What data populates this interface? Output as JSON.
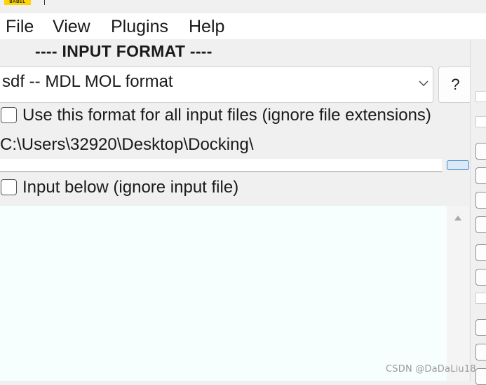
{
  "app": {
    "logo_text": "BABEL"
  },
  "menu": {
    "items": [
      "File",
      "View",
      "Plugins",
      "Help"
    ]
  },
  "input_format": {
    "section_title": "---- INPUT FORMAT ----",
    "selected_format": "sdf -- MDL MOL format",
    "help_label": "?",
    "use_for_all_label": "Use this format for all input files (ignore file extensions)",
    "use_for_all_checked": false,
    "input_path": "C:\\Users\\32920\\Desktop\\Docking\\",
    "file_field_value": "",
    "input_below_label": "Input below (ignore input file)",
    "input_below_checked": false,
    "input_text": ""
  },
  "icons": {
    "dropdown": "chevron-down-icon",
    "scroll_up": "triangle-up-icon"
  },
  "colors": {
    "menubar_bg": "#ffffff",
    "window_bg": "#f0f0f0",
    "text_area_bg": "#f7fefe",
    "browse_accent": "#3c86cc"
  },
  "watermark": "CSDN @DaDaLiu18"
}
